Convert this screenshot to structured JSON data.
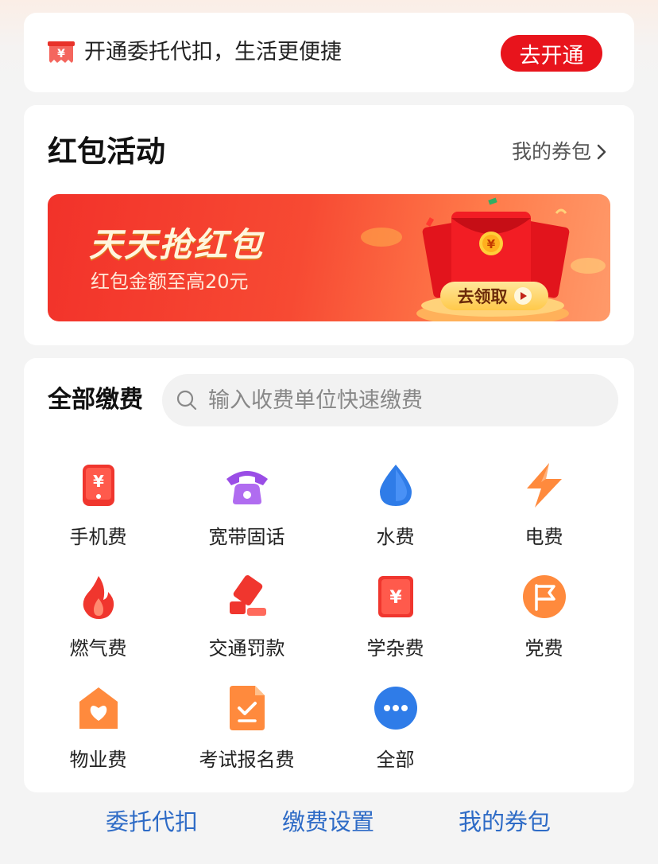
{
  "autopay": {
    "icon": "ticket-yuan-icon",
    "message": "开通委托代扣，生活更便捷",
    "button": "去开通"
  },
  "redpacket": {
    "title": "红包活动",
    "wallet_link": "我的券包",
    "banner": {
      "title": "天天抢红包",
      "subtitle": "红包金额至高20元",
      "claim_button": "去领取"
    }
  },
  "payments": {
    "title": "全部缴费",
    "search_placeholder": "输入收费单位快速缴费",
    "items": [
      {
        "label": "手机费",
        "icon": "phone-bill-icon",
        "color": "#f0362e"
      },
      {
        "label": "宽带固话",
        "icon": "telephone-icon",
        "color": "#9a4de6"
      },
      {
        "label": "水费",
        "icon": "water-drop-icon",
        "color": "#2f7ce8"
      },
      {
        "label": "电费",
        "icon": "lightning-icon",
        "color": "#ff8a3d"
      },
      {
        "label": "燃气费",
        "icon": "flame-icon",
        "color": "#f0362e"
      },
      {
        "label": "交通罚款",
        "icon": "traffic-fine-icon",
        "color": "#f0362e"
      },
      {
        "label": "学杂费",
        "icon": "tuition-bill-icon",
        "color": "#f0362e"
      },
      {
        "label": "党费",
        "icon": "party-flag-icon",
        "color": "#ff8a3d"
      },
      {
        "label": "物业费",
        "icon": "house-heart-icon",
        "color": "#ff8a3d"
      },
      {
        "label": "考试报名费",
        "icon": "exam-document-icon",
        "color": "#ff8a3d"
      },
      {
        "label": "全部",
        "icon": "more-dots-icon",
        "color": "#2f7ce8"
      }
    ]
  },
  "footer": {
    "links": [
      "委托代扣",
      "缴费设置",
      "我的券包"
    ]
  },
  "colors": {
    "accent_red": "#e8141c",
    "link_blue": "#2e6bc6",
    "icon_orange": "#ff8a3d",
    "icon_blue": "#2f7ce8"
  }
}
